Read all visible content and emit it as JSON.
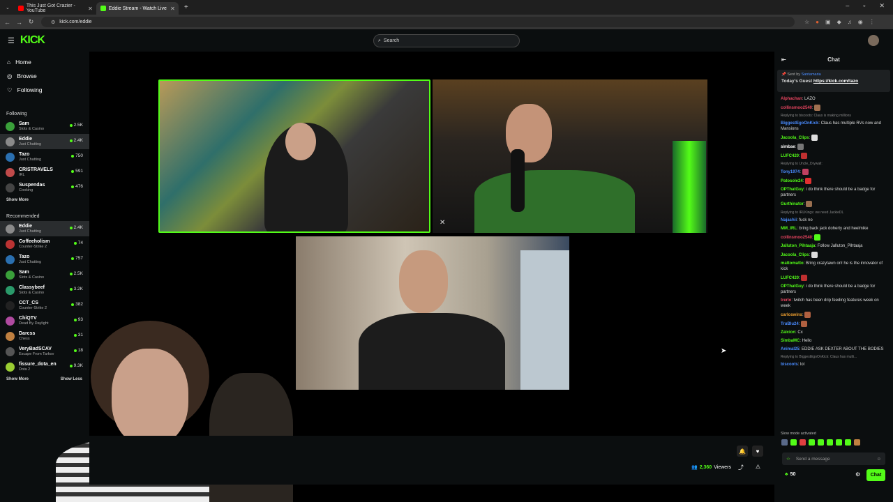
{
  "browser": {
    "tabs": [
      {
        "title": "This Just Got Crazier - YouTube",
        "color": "#ff0000"
      },
      {
        "title": "Eddie Stream - Watch Live",
        "color": "#53fc18"
      }
    ],
    "url": "kick.com/eddie"
  },
  "topbar": {
    "logo": "KICK",
    "search_placeholder": "Search"
  },
  "sidebar": {
    "nav": [
      {
        "label": "Home",
        "icon": "home-icon"
      },
      {
        "label": "Browse",
        "icon": "browse-icon"
      },
      {
        "label": "Following",
        "icon": "heart-icon"
      }
    ],
    "following_title": "Following",
    "following": [
      {
        "name": "Sam",
        "category": "Slots & Casino",
        "viewers": "2.5K",
        "color": "#3aa03a"
      },
      {
        "name": "Eddie",
        "category": "Just Chatting",
        "viewers": "2.4K",
        "color": "#8a8a8a"
      },
      {
        "name": "Tazo",
        "category": "Just Chatting",
        "viewers": "750",
        "color": "#2a6fb0"
      },
      {
        "name": "CRISTRAVELS",
        "category": "IRL",
        "viewers": "591",
        "color": "#c04a4a"
      },
      {
        "name": "Suspendas",
        "category": "Cooking",
        "viewers": "476",
        "color": "#444"
      }
    ],
    "show_more": "Show More",
    "recommended_title": "Recommended",
    "recommended": [
      {
        "name": "Eddie",
        "category": "Just Chatting",
        "viewers": "2.4K",
        "color": "#8a8a8a"
      },
      {
        "name": "Coffeeholism",
        "category": "Counter-Strike 2",
        "viewers": "74",
        "color": "#b33"
      },
      {
        "name": "Tazo",
        "category": "Just Chatting",
        "viewers": "757",
        "color": "#2a6fb0"
      },
      {
        "name": "Sam",
        "category": "Slots & Casino",
        "viewers": "2.5K",
        "color": "#3aa03a"
      },
      {
        "name": "Classybeef",
        "category": "Slots & Casino",
        "viewers": "3.2K",
        "color": "#2a9a6a"
      },
      {
        "name": "CCT_CS",
        "category": "Counter-Strike 2",
        "viewers": "382",
        "color": "#222"
      },
      {
        "name": "ChiQTV",
        "category": "Dead By Daylight",
        "viewers": "93",
        "color": "#b04aa0"
      },
      {
        "name": "Darcss",
        "category": "Chess",
        "viewers": "31",
        "color": "#c08040"
      },
      {
        "name": "VeryBadSCAV",
        "category": "Escape From Tarkov",
        "viewers": "18",
        "color": "#555"
      },
      {
        "name": "fissure_dota_en",
        "category": "Dota 2",
        "viewers": "9.3K",
        "color": "#9acd32"
      }
    ],
    "show_more2": "Show More",
    "show_less": "Show Less"
  },
  "player": {
    "viewers": "2,360",
    "viewers_label": "Viewers"
  },
  "chat": {
    "title": "Chat",
    "pinned_sent_by": "Sent by",
    "pinned_user": "Santamaria",
    "pinned_text": "Today's Guest",
    "pinned_link": "https://kick.com/tazo",
    "messages": [
      {
        "user": "Alphachan",
        "text": "LAZO",
        "color": "#e94560"
      },
      {
        "user": "collinsmoo2540",
        "text": "",
        "color": "#e94560",
        "emote": "#a07050"
      },
      {
        "reply": "Replying to biscoots: Claus is making millions"
      },
      {
        "user": "BiggestEgoOnKick",
        "text": "Claus has multiple RVs now and Mansions",
        "color": "#4a8cff"
      },
      {
        "user": "Jacoola_Clips",
        "text": "",
        "color": "#53fc18",
        "emote": "#ddd"
      },
      {
        "user": "simbae",
        "text": "",
        "color": "#ffffff",
        "emote": "#777"
      },
      {
        "user": "LUFC420",
        "text": "",
        "color": "#53fc18",
        "emote": "#c03030"
      },
      {
        "reply": "Replying to Uncle_Drywall:"
      },
      {
        "user": "Tony1974",
        "text": "",
        "color": "#4a8cff",
        "emote": "#c04060"
      },
      {
        "user": "Patosole24",
        "text": "",
        "color": "#53fc18",
        "emote": "#e03030"
      },
      {
        "user": "OPThatGuy",
        "text": "i do think there should be a badge for partners",
        "color": "#53fc18"
      },
      {
        "user": "Gurthinator",
        "text": "",
        "color": "#53fc18",
        "emote": "#9a7050"
      },
      {
        "reply": "Replying to IRLKings: we need JackieDL"
      },
      {
        "user": "Najashii",
        "text": "fuck no",
        "color": "#4a8cff"
      },
      {
        "user": "MM_IRL",
        "text": "bring back jack doherty and heelmike",
        "color": "#53fc18"
      },
      {
        "user": "collinsmoo2540",
        "text": "",
        "color": "#e94560",
        "emote": "#53fc18"
      },
      {
        "user": "Jalluton_Pihtaaja",
        "text": "Follow Jalluton_Pihtaaja",
        "color": "#53fc18"
      },
      {
        "user": "Jacoola_Clips",
        "text": "",
        "color": "#53fc18",
        "emote": "#ddd"
      },
      {
        "user": "mattomatto",
        "text": "Bring crazytawn on! he is the innovator of kick",
        "color": "#53fc18"
      },
      {
        "user": "LUFC420",
        "text": "",
        "color": "#53fc18",
        "emote": "#c03030"
      },
      {
        "user": "OPThatGuy",
        "text": "i do think there should be a badge for partners",
        "color": "#53fc18"
      },
      {
        "user": "trerlo",
        "text": "twitch has been drip feeding features week on week",
        "color": "#e94560"
      },
      {
        "user": "carloswins",
        "text": "",
        "color": "#f0a030",
        "emote": "#b06040"
      },
      {
        "user": "TruBlu24",
        "text": "",
        "color": "#4a8cff",
        "emote": "#b06040"
      },
      {
        "user": "Zalcion",
        "text": "Cx",
        "color": "#53fc18"
      },
      {
        "user": "SimbaMC",
        "text": "Hello",
        "color": "#53fc18"
      },
      {
        "user": "Animal25",
        "text": "EDDIE ASK DEXTER ABOUT THE BODIES",
        "color": "#4a8cff"
      },
      {
        "reply": "Replying to BiggestEgoOnKick: Claus has multi..."
      },
      {
        "user": "biscoots",
        "text": "lol",
        "color": "#4a8cff"
      }
    ],
    "slow_mode": "Slow mode activated",
    "input_placeholder": "Send a message",
    "points": "50",
    "send_label": "Chat"
  }
}
